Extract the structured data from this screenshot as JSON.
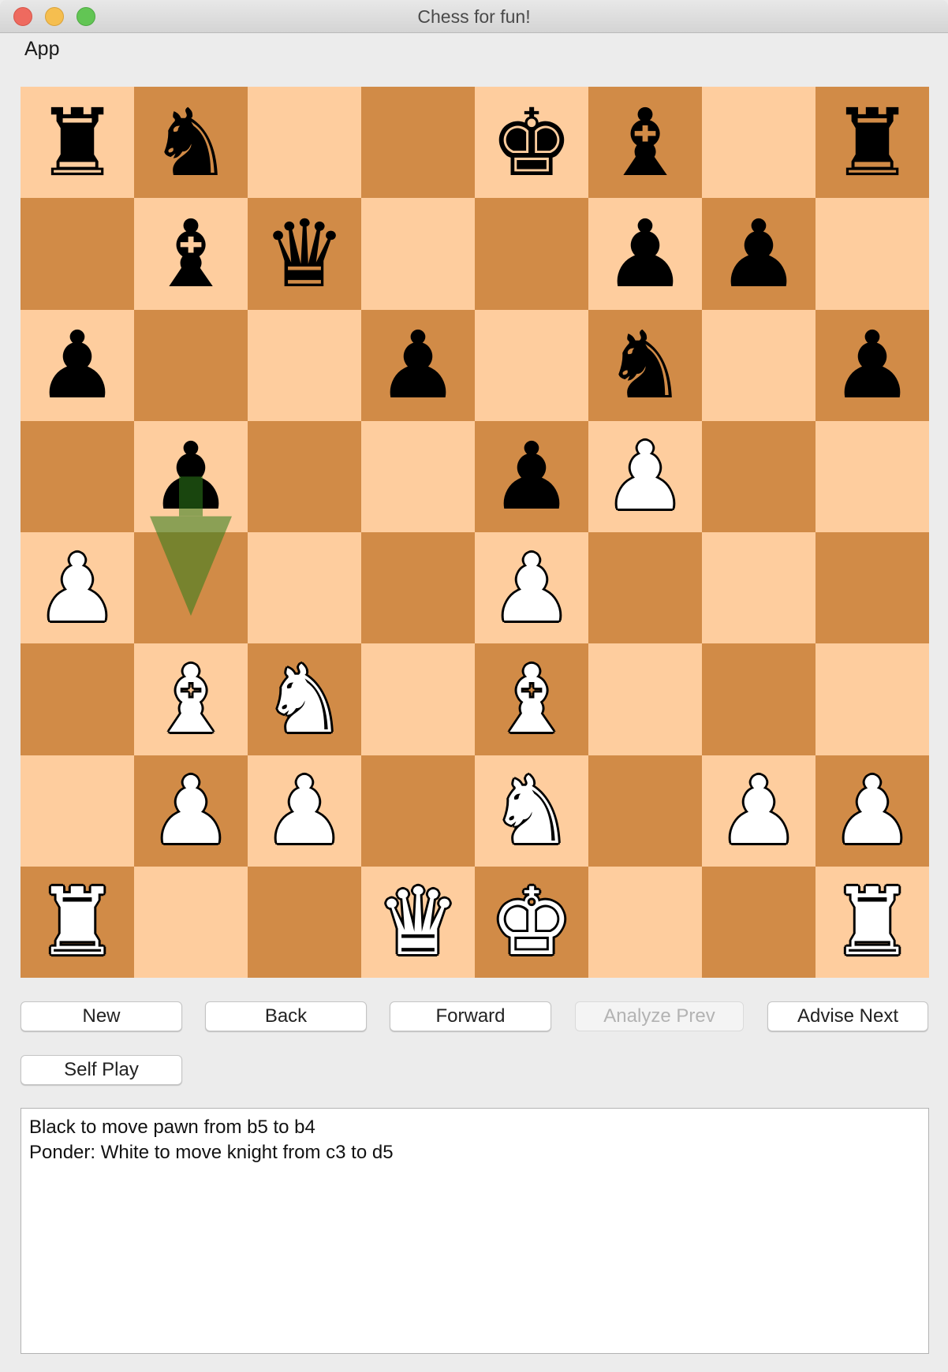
{
  "window": {
    "title": "Chess for fun!",
    "controls": [
      "close",
      "minimize",
      "zoom"
    ]
  },
  "menubar": {
    "items": [
      {
        "label": "App"
      }
    ]
  },
  "board": {
    "orientation": "white-bottom",
    "colors": {
      "light": "#fecd9e",
      "dark": "#d18b47"
    },
    "ranks": [
      [
        "bR",
        "bN",
        "",
        "",
        "bK",
        "bB",
        "",
        "bR"
      ],
      [
        "",
        "bB",
        "bQ",
        "",
        "",
        "bP",
        "bP",
        ""
      ],
      [
        "bP",
        "",
        "",
        "bP",
        "",
        "bN",
        "",
        "bP"
      ],
      [
        "",
        "bP",
        "",
        "",
        "bP",
        "wP",
        "",
        ""
      ],
      [
        "wP",
        "",
        "",
        "",
        "wP",
        "",
        "",
        ""
      ],
      [
        "",
        "wB",
        "wN",
        "",
        "wB",
        "",
        "",
        ""
      ],
      [
        "",
        "wP",
        "wP",
        "",
        "wN",
        "",
        "wP",
        "wP"
      ],
      [
        "wR",
        "",
        "",
        "wQ",
        "wK",
        "",
        "",
        "wR"
      ]
    ],
    "glyphs": {
      "K": "♚",
      "Q": "♛",
      "R": "♜",
      "B": "♝",
      "N": "♞",
      "P": "♟"
    },
    "piece_names": {
      "K": "king",
      "Q": "queen",
      "R": "rook",
      "B": "bishop",
      "N": "knight",
      "P": "pawn"
    },
    "move_arrow": {
      "from": "b5",
      "to": "b4",
      "color": "#2e7d1a"
    }
  },
  "buttons": [
    {
      "id": "new",
      "label": "New",
      "enabled": true
    },
    {
      "id": "back",
      "label": "Back",
      "enabled": true
    },
    {
      "id": "forward",
      "label": "Forward",
      "enabled": true
    },
    {
      "id": "analyze-prev",
      "label": "Analyze Prev",
      "enabled": false
    },
    {
      "id": "advise-next",
      "label": "Advise Next",
      "enabled": true
    },
    {
      "id": "self-play",
      "label": "Self Play",
      "enabled": true
    }
  ],
  "log": {
    "lines": [
      "Black to move pawn from b5 to b4",
      "Ponder: White to move knight from c3 to d5"
    ]
  }
}
